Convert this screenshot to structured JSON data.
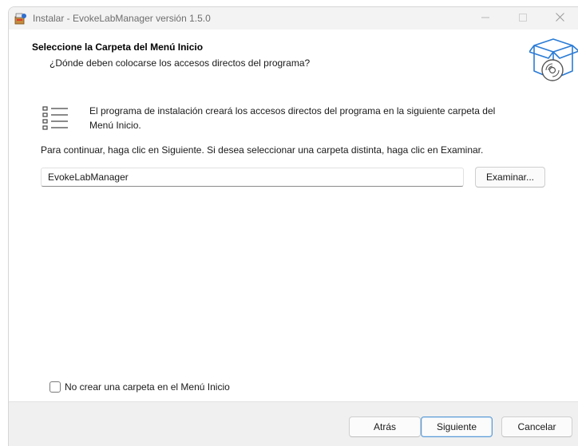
{
  "window": {
    "title": "Instalar - EvokeLabManager versión 1.5.0",
    "app_icon": "setup-box-icon",
    "controls": [
      "minimize-icon",
      "maximize-icon",
      "close-icon"
    ]
  },
  "header": {
    "title": "Seleccione la Carpeta del Menú Inicio",
    "subtitle": "¿Dónde deben colocarse los accesos directos del programa?",
    "icon": "software-box-cd-icon"
  },
  "body": {
    "list_icon": "start-menu-list-icon",
    "info_line1": "El programa de instalación creará los accesos directos del programa en la siguiente carpeta del",
    "info_line2": "Menú Inicio.",
    "continue_text": "Para continuar, haga clic en Siguiente. Si desea seleccionar una carpeta distinta, haga clic en Examinar.",
    "folder_value": "EvokeLabManager",
    "browse_label": "Examinar...",
    "checkbox_label": "No crear una carpeta en el Menú Inicio",
    "checkbox_checked": false
  },
  "footer": {
    "back_label": "Atrás",
    "next_label": "Siguiente",
    "cancel_label": "Cancelar"
  },
  "colors": {
    "accent": "#3c8be3",
    "footer_bg": "#f0f0f0",
    "titlebar_bg": "#f3f3f3"
  }
}
